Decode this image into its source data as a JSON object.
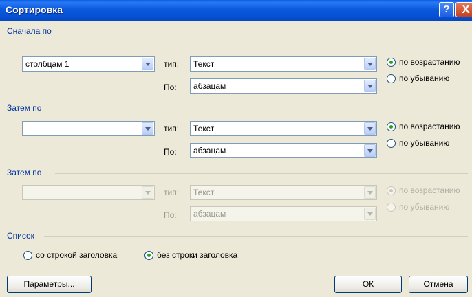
{
  "window": {
    "title": "Сортировка",
    "help_button": "?",
    "close_button": "X"
  },
  "first": {
    "group_label": "Сначала по",
    "field_value": "столбцам 1",
    "type_label": "тип:",
    "type_value": "Текст",
    "by_label": "По:",
    "by_value": "абзацам",
    "asc_label": "по возрастанию",
    "desc_label": "по убыванию",
    "selected": "asc"
  },
  "second": {
    "group_label": "Затем по",
    "field_value": "",
    "type_label": "тип:",
    "type_value": "Текст",
    "by_label": "По:",
    "by_value": "абзацам",
    "asc_label": "по возрастанию",
    "desc_label": "по убыванию",
    "selected": "asc"
  },
  "third": {
    "group_label": "Затем по",
    "field_value": "",
    "type_label": "тип:",
    "type_value": "Текст",
    "by_label": "По:",
    "by_value": "абзацам",
    "asc_label": "по возрастанию",
    "desc_label": "по убыванию",
    "selected": "asc",
    "disabled": true
  },
  "list": {
    "group_label": "Список",
    "with_header_label": "со строкой заголовка",
    "without_header_label": "без строки заголовка",
    "selected": "without_header"
  },
  "buttons": {
    "options_label": "Параметры...",
    "ok_label": "ОК",
    "cancel_label": "Отмена"
  }
}
